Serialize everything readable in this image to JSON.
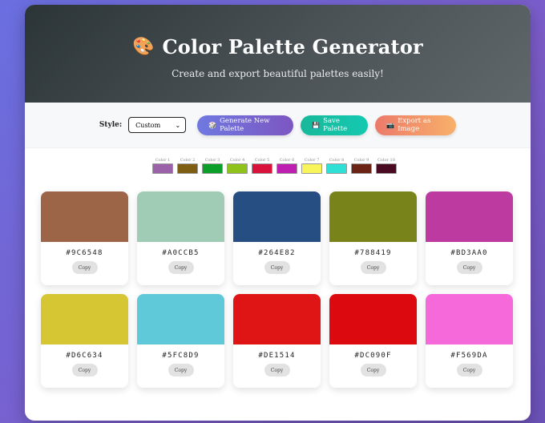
{
  "header": {
    "icon": "palette-icon",
    "icon_glyph": "🎨",
    "title": "Color Palette Generator",
    "subtitle": "Create and export beautiful palettes easily!"
  },
  "controls": {
    "style_label": "Style:",
    "style_value": "Custom",
    "generate": {
      "icon": "🎲",
      "label": "Generate New Palette"
    },
    "save": {
      "icon": "💾",
      "label": "Save Palette"
    },
    "export": {
      "icon": "📷",
      "label": "Export as Image"
    }
  },
  "swatches": [
    {
      "label": "Color 1",
      "color": "#9b62a9"
    },
    {
      "label": "Color 2",
      "color": "#7d5e12"
    },
    {
      "label": "Color 3",
      "color": "#0ca02a"
    },
    {
      "label": "Color 4",
      "color": "#8fc21a"
    },
    {
      "label": "Color 5",
      "color": "#d8123a"
    },
    {
      "label": "Color 6",
      "color": "#bf1fb0"
    },
    {
      "label": "Color 7",
      "color": "#f7f55a"
    },
    {
      "label": "Color 8",
      "color": "#2fe0d6"
    },
    {
      "label": "Color 9",
      "color": "#6b2414"
    },
    {
      "label": "Color 10",
      "color": "#4a0a22"
    }
  ],
  "cards": [
    {
      "hex": "#9C6548",
      "color": "#9C6548",
      "copy": "Copy"
    },
    {
      "hex": "#A0CCB5",
      "color": "#A0CCB5",
      "copy": "Copy"
    },
    {
      "hex": "#264E82",
      "color": "#264E82",
      "copy": "Copy"
    },
    {
      "hex": "#788419",
      "color": "#788419",
      "copy": "Copy"
    },
    {
      "hex": "#BD3AA0",
      "color": "#BD3AA0",
      "copy": "Copy"
    },
    {
      "hex": "#D6C634",
      "color": "#D6C634",
      "copy": "Copy"
    },
    {
      "hex": "#5FC8D9",
      "color": "#5FC8D9",
      "copy": "Copy"
    },
    {
      "hex": "#DE1514",
      "color": "#DE1514",
      "copy": "Copy"
    },
    {
      "hex": "#DC090F",
      "color": "#DC090F",
      "copy": "Copy"
    },
    {
      "hex": "#F569DA",
      "color": "#F569DA",
      "copy": "Copy"
    }
  ]
}
